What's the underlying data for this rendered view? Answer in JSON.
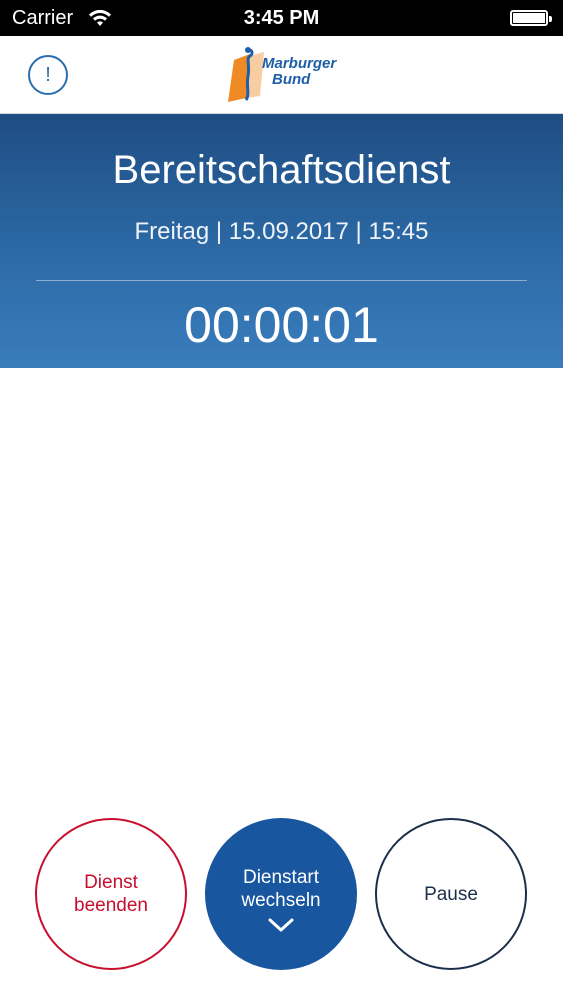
{
  "status_bar": {
    "carrier": "Carrier",
    "time": "3:45 PM",
    "wifi_icon": "wifi-icon",
    "battery_icon": "battery-icon"
  },
  "nav": {
    "info_icon": "info-icon",
    "info_glyph": "!",
    "logo": {
      "line1": "Marburger",
      "line2": "Bund",
      "brand_color": "#1f5fa8",
      "accent_color": "#f08a24"
    }
  },
  "header": {
    "title": "Bereitschaftsdienst",
    "date_line": "Freitag | 15.09.2017 | 15:45",
    "timer": "00:00:01",
    "gradient_top": "#1f4d83",
    "gradient_bottom": "#3a7dbd"
  },
  "actions": {
    "end": {
      "line1": "Dienst",
      "line2": "beenden",
      "color": "#c8102e"
    },
    "switch": {
      "line1": "Dienstart",
      "line2": "wechseln",
      "icon": "chevron-down-icon",
      "color": "#1856a0"
    },
    "pause": {
      "label": "Pause",
      "color": "#1b2f4a"
    }
  }
}
